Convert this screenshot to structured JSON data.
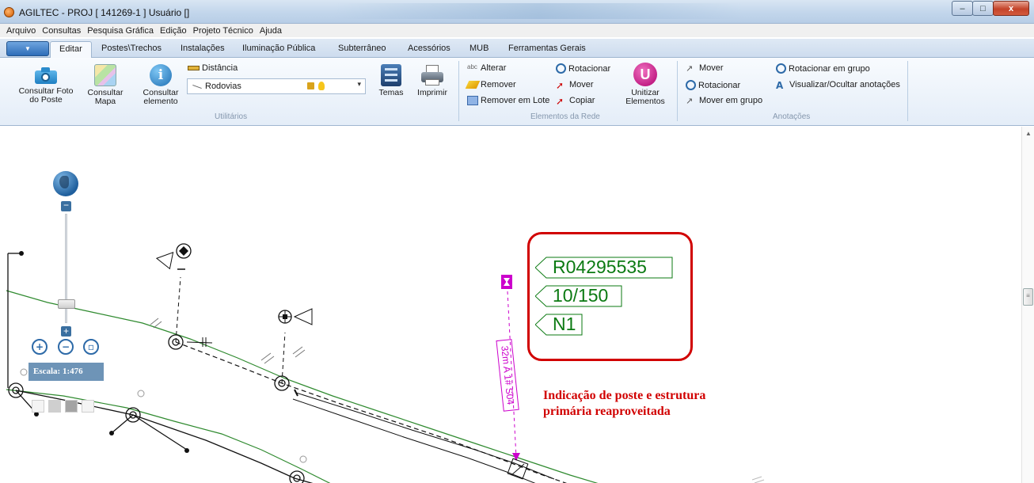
{
  "window": {
    "title": "AGILTEC - PROJ [ 141269-1 ] Usuário []",
    "controls": {
      "minimize": "–",
      "maximize": "□",
      "close": "x"
    }
  },
  "menu": [
    "Arquivo",
    "Consultas",
    "Pesquisa Gráfica",
    "Edição",
    "Projeto Técnico",
    "Ajuda"
  ],
  "tabs": [
    "Editar",
    "Postes\\Trechos",
    "Instalações",
    "Iluminação Pública",
    "Subterrâneo",
    "Acessórios",
    "MUB",
    "Ferramentas Gerais"
  ],
  "ribbon": {
    "utilitarios": {
      "label": "Utilitários",
      "consultar_foto": "Consultar Foto do Poste",
      "consultar_mapa": "Consultar Mapa",
      "consultar_elemento": "Consultar elemento",
      "distancia": "Distância",
      "combo_value": "Rodovias",
      "temas": "Temas",
      "imprimir": "Imprimir"
    },
    "elementos": {
      "label": "Elementos da Rede",
      "alterar": "Alterar",
      "remover": "Remover",
      "remover_lote": "Remover em Lote",
      "rotacionar": "Rotacionar",
      "mover": "Mover",
      "copiar": "Copiar",
      "unitizar": "Unitizar Elementos"
    },
    "anotacoes": {
      "label": "Anotações",
      "mover": "Mover",
      "rotacionar": "Rotacionar",
      "mover_grupo": "Mover em grupo",
      "rotacionar_grupo": "Rotacionar em grupo",
      "visualizar": "Visualizar/Ocultar anotações"
    }
  },
  "map": {
    "scale": "Escala: 1:476",
    "span_label": "32m A 1# S04",
    "tags": [
      "R04295535",
      "10/150",
      "N1"
    ],
    "caption_line1": "Indicação de poste e estrutura",
    "caption_line2": "primária reaproveitada"
  },
  "colors": {
    "accent_red": "#d10000",
    "tag_green": "#0b7a12",
    "magenta": "#cc00cc",
    "line_green": "#2f8a2f"
  }
}
